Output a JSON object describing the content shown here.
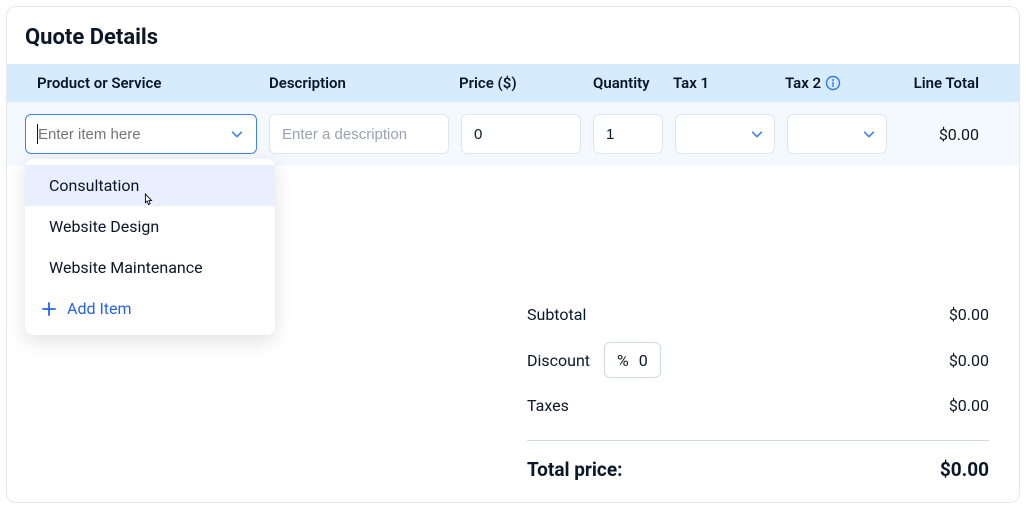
{
  "title": "Quote Details",
  "headers": {
    "product": "Product or Service",
    "description": "Description",
    "price": "Price ($)",
    "quantity": "Quantity",
    "tax1": "Tax 1",
    "tax2": "Tax 2",
    "line_total": "Line Total"
  },
  "row": {
    "product_placeholder": "Enter item here",
    "description_placeholder": "Enter a description",
    "price_value": "0",
    "qty_value": "1",
    "line_total": "$0.00"
  },
  "dropdown": {
    "items": [
      "Consultation",
      "Website Design",
      "Website Maintenance"
    ],
    "add_item": "Add Item"
  },
  "totals": {
    "subtotal_label": "Subtotal",
    "subtotal_value": "$0.00",
    "discount_label": "Discount",
    "discount_symbol": "%",
    "discount_value": "0",
    "discount_total": "$0.00",
    "taxes_label": "Taxes",
    "taxes_value": "$0.00",
    "total_label": "Total price:",
    "total_value": "$0.00"
  }
}
